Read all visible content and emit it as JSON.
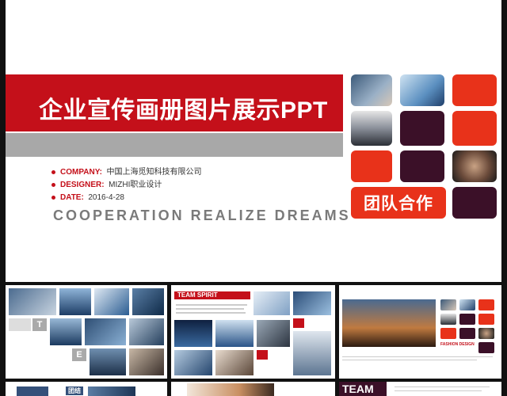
{
  "slide": {
    "title": "企业宣传画册图片展示PPT",
    "info": [
      {
        "key": "COMPANY:",
        "value": "中国上海觅知科技有限公司"
      },
      {
        "key": "DESIGNER:",
        "value": "MIZHI职业设计"
      },
      {
        "key": "DATE:",
        "value": "2016-4-28"
      }
    ],
    "slogan": "COOPERATION REALIZE DREAMS",
    "team_label": "团队合作"
  },
  "thumbnails": {
    "t1": {
      "letters": [
        "T",
        "E"
      ]
    },
    "t2": {
      "banner": "TEAM SPIRIT"
    },
    "t3": {
      "caption": "FASHION DESIGN"
    },
    "t4": {
      "label": "团结"
    },
    "t6": {
      "label": "TEAM"
    }
  },
  "colors": {
    "accent_red": "#c4101a",
    "tile_orange": "#e8321a",
    "tile_purple": "#3b1028",
    "bar_gray": "#a8a8a8",
    "background": "#111111"
  },
  "icons": {
    "bullet": "red-dot-icon"
  }
}
